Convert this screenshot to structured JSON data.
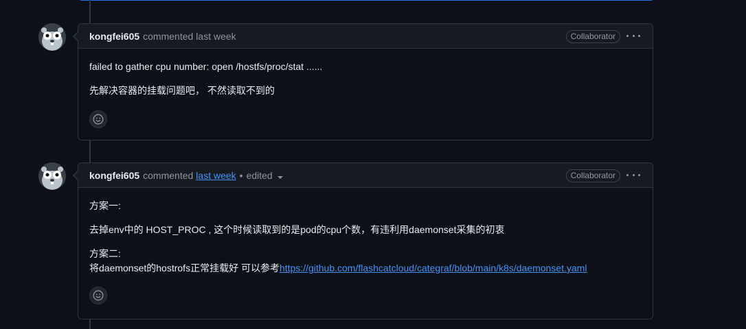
{
  "comments": [
    {
      "author": "kongfei605",
      "action": "commented",
      "time": "last week",
      "badge": "Collaborator",
      "paragraphs": [
        "failed to gather cpu number: open /hostfs/proc/stat ......",
        "先解决容器的挂载问题吧， 不然读取不到的"
      ]
    },
    {
      "author": "kongfei605",
      "action": "commented",
      "time": "last week",
      "separator": "•",
      "edited": "edited",
      "badge": "Collaborator",
      "p1": "方案一:",
      "p2": "去掉env中的 HOST_PROC , 这个时候读取到的是pod的cpu个数，有违利用daemonset采集的初衷",
      "p3_line1": "方案二:",
      "p3_line2_prefix": "将daemonset的hostrofs正常挂载好 可以参考",
      "p3_link": "https://github.com/flashcatcloud/categraf/blob/main/k8s/daemonset.yaml"
    }
  ],
  "icons": {
    "avatar": "gopher-avatar-icon",
    "menu": "kebab-horizontal-icon",
    "reaction": "smiley-icon",
    "edit_menu": "triangle-down-icon"
  },
  "colors": {
    "background": "#0d1117",
    "header": "#161b22",
    "border": "#30363d",
    "link": "#4493f8",
    "muted": "#8d96a0",
    "focus_border": "#1f6feb"
  }
}
